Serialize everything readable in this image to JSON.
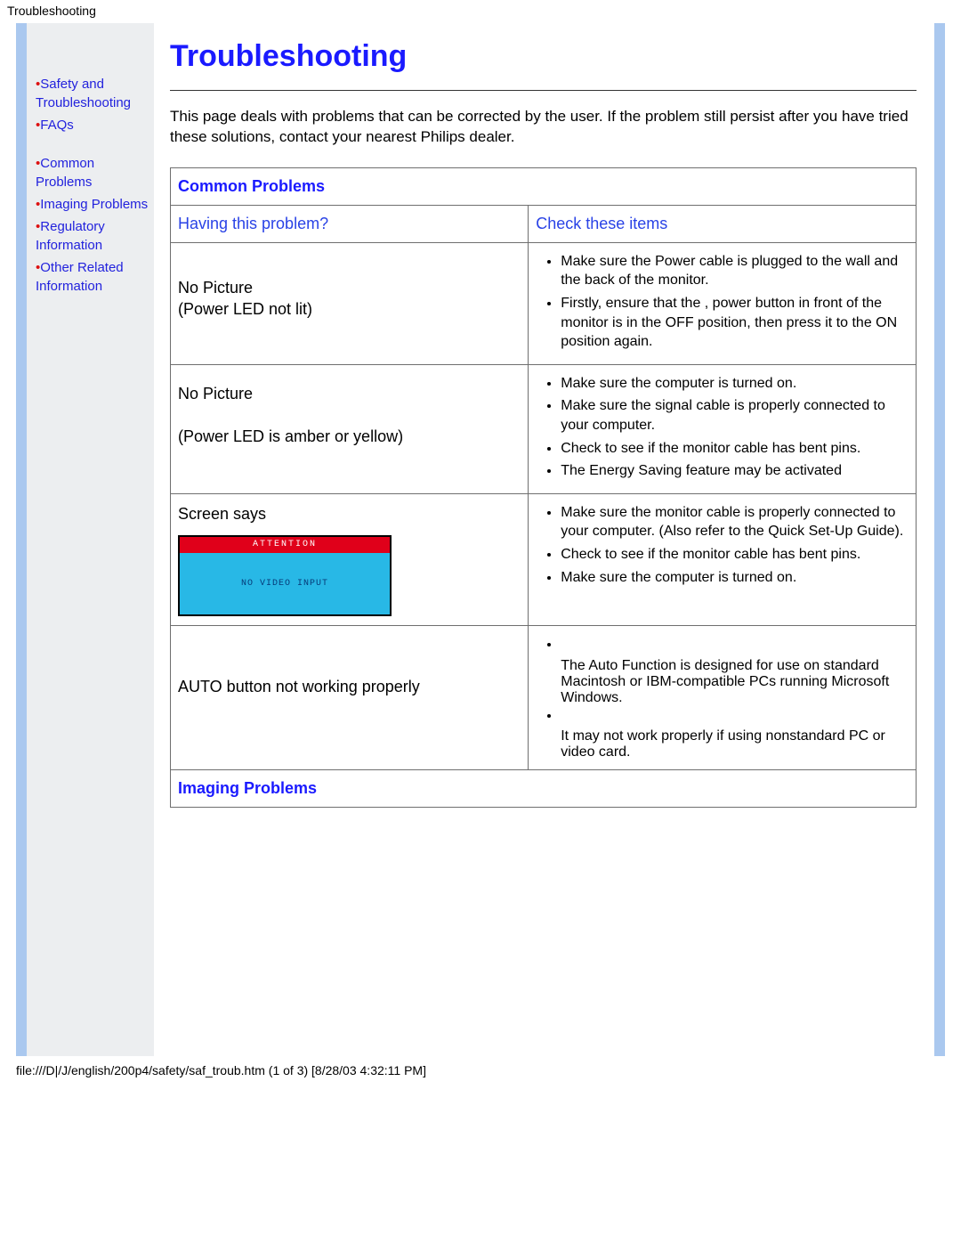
{
  "browser": {
    "page_label": "Troubleshooting"
  },
  "sidebar": {
    "items": [
      {
        "label": "Safety and Troubleshooting"
      },
      {
        "label": "FAQs"
      },
      {
        "label": "Common Problems"
      },
      {
        "label": "Imaging Problems"
      },
      {
        "label": "Regulatory Information"
      },
      {
        "label": "Other Related Information"
      }
    ]
  },
  "main": {
    "title": "Troubleshooting",
    "intro": "This page deals with problems that can be corrected by the user. If the problem still persist after you have tried these solutions, contact your nearest Philips dealer.",
    "sections": {
      "common_label": "Common Problems",
      "imaging_label": "Imaging Problems"
    },
    "columns": {
      "left": "Having this problem?",
      "right": "Check these items"
    },
    "rows": [
      {
        "problem_lines": [
          "No Picture",
          "(Power LED not lit)"
        ],
        "checks": [
          "Make sure the Power cable is plugged to the wall and the back of the monitor.",
          "Firstly, ensure that the , power button in front of the monitor is in the OFF position, then press it to the ON position again."
        ]
      },
      {
        "problem_lines": [
          "No Picture",
          "",
          "(Power LED is amber or yellow)"
        ],
        "checks": [
          "Make sure the computer is turned on.",
          "Make sure the signal cable is properly connected to your computer.",
          "Check to see if the monitor cable has bent pins.",
          "The Energy Saving feature may be activated"
        ]
      },
      {
        "problem_lines": [
          "Screen says"
        ],
        "monitor": {
          "bar": "ATTENTION",
          "body": "NO VIDEO INPUT"
        },
        "checks": [
          "Make sure the monitor cable is properly connected to your computer. (Also refer to the Quick Set-Up Guide).",
          "Check to see if the monitor cable has bent pins.",
          "Make sure the computer is turned on."
        ]
      },
      {
        "problem_lines": [
          "AUTO button not working properly"
        ],
        "checks_blanklead": [
          "",
          "The Auto Function is designed for use on standard Macintosh or IBM-compatible PCs running Microsoft Windows.",
          "",
          "It may not work properly if using nonstandard PC or video card."
        ]
      }
    ]
  },
  "footer": {
    "status": "file:///D|/J/english/200p4/safety/saf_troub.htm (1 of 3) [8/28/03 4:32:11 PM]"
  }
}
